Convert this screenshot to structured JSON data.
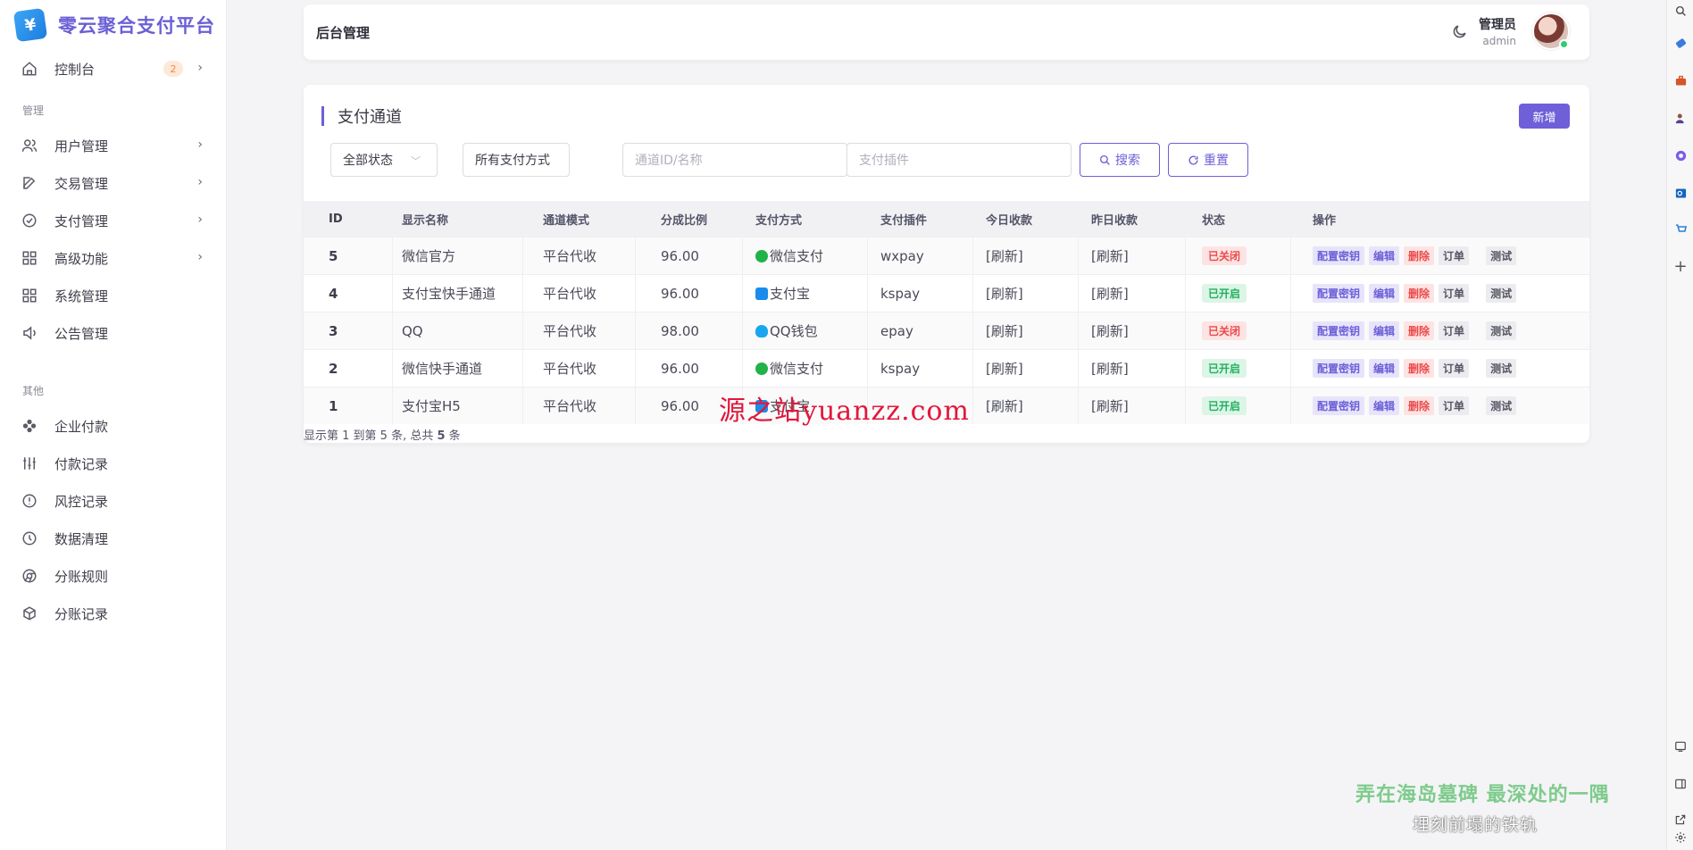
{
  "brand": {
    "logo_char": "¥",
    "name": "零云聚合支付平台"
  },
  "sidebar": {
    "dashboard": {
      "label": "控制台",
      "badge": "2"
    },
    "section_manage": "管理",
    "manage_items": [
      {
        "label": "用户管理",
        "icon": "users-icon",
        "has_chevron": true
      },
      {
        "label": "交易管理",
        "icon": "edit-icon",
        "has_chevron": true
      },
      {
        "label": "支付管理",
        "icon": "check-circle-icon",
        "has_chevron": true
      },
      {
        "label": "高级功能",
        "icon": "grid-icon",
        "has_chevron": true
      },
      {
        "label": "系统管理",
        "icon": "grid-icon",
        "has_chevron": false
      },
      {
        "label": "公告管理",
        "icon": "speaker-icon",
        "has_chevron": false
      }
    ],
    "section_other": "其他",
    "other_items": [
      {
        "label": "企业付款",
        "icon": "flower-icon"
      },
      {
        "label": "付款记录",
        "icon": "sliders-icon"
      },
      {
        "label": "风控记录",
        "icon": "alert-circle-icon"
      },
      {
        "label": "数据清理",
        "icon": "clock-icon"
      },
      {
        "label": "分账规则",
        "icon": "chrome-icon"
      },
      {
        "label": "分账记录",
        "icon": "box-icon"
      }
    ]
  },
  "header": {
    "title": "后台管理",
    "user_role": "管理员",
    "user_name": "admin"
  },
  "main": {
    "title": "支付通道",
    "new_button": "新增",
    "filters": {
      "status": "全部状态",
      "pay_type": "所有支付方式",
      "channel_placeholder": "通道ID/名称",
      "plugin_placeholder": "支付插件",
      "search": "搜索",
      "reset": "重置"
    },
    "table": {
      "headers": [
        "ID",
        "显示名称",
        "通道模式",
        "分成比例",
        "支付方式",
        "支付插件",
        "今日收款",
        "昨日收款",
        "状态",
        "操作"
      ],
      "rows": [
        {
          "id": "5",
          "name": "微信官方",
          "mode": "平台代收",
          "ratio": "96.00",
          "pay": "微信支付",
          "pay_icon": "wechat-icon",
          "plugin": "wxpay",
          "today": "[刷新]",
          "yesterday": "[刷新]",
          "status": "已关闭",
          "status_on": false
        },
        {
          "id": "4",
          "name": "支付宝快手通道",
          "mode": "平台代收",
          "ratio": "96.00",
          "pay": "支付宝",
          "pay_icon": "alipay-icon",
          "plugin": "kspay",
          "today": "[刷新]",
          "yesterday": "[刷新]",
          "status": "已开启",
          "status_on": true
        },
        {
          "id": "3",
          "name": "QQ",
          "mode": "平台代收",
          "ratio": "98.00",
          "pay": "QQ钱包",
          "pay_icon": "qq-icon",
          "plugin": "epay",
          "today": "[刷新]",
          "yesterday": "[刷新]",
          "status": "已关闭",
          "status_on": false
        },
        {
          "id": "2",
          "name": "微信快手通道",
          "mode": "平台代收",
          "ratio": "96.00",
          "pay": "微信支付",
          "pay_icon": "wechat-icon",
          "plugin": "kspay",
          "today": "[刷新]",
          "yesterday": "[刷新]",
          "status": "已开启",
          "status_on": true
        },
        {
          "id": "1",
          "name": "支付宝H5",
          "mode": "平台代收",
          "ratio": "96.00",
          "pay": "支付宝",
          "pay_icon": "alipay-icon",
          "plugin": "",
          "today": "[刷新]",
          "yesterday": "[刷新]",
          "status": "已开启",
          "status_on": true
        }
      ],
      "ops": {
        "key": "配置密钥",
        "edit": "编辑",
        "del": "删除",
        "order": "订单",
        "test": "测试"
      }
    },
    "footer": {
      "prefix": "显示第 1 到第 5 条, 总共 ",
      "total": "5",
      "suffix": " 条"
    }
  },
  "watermark": "源之站yuanzz.com",
  "overlay_subtitle_1": "弄在海岛墓碑 最深处的一隅",
  "overlay_subtitle_2": "埋刻前塌的铁轨",
  "colors": {
    "accent": "#6c5fd8",
    "danger": "#ea4b4b",
    "success": "#23b05f"
  }
}
